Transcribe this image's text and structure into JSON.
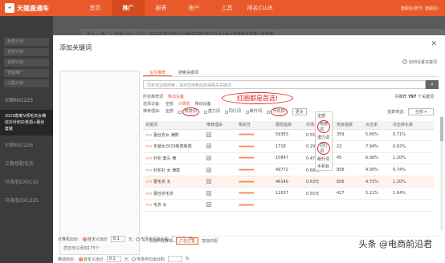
{
  "topbar": {
    "logo_text": "天猫直通车",
    "nav": [
      "首页",
      "推广",
      "报表",
      "账户",
      "工具",
      "排名CLUB"
    ],
    "active_index": 1,
    "user_text": "旗舰店(账号: 旗舰店)"
  },
  "sidebar": {
    "buttons": [
      "新建计划",
      "全部计划",
      "全部计划",
      "智能推广",
      "三联计划"
    ],
    "group_label": "V领R0I1225",
    "active_item": "2019款新V领毛衣女横纹衫针织衫低领+蕾丝套装",
    "items": [
      "V领R0I1226",
      "三套搭配毛衣",
      "马海毛DX0110",
      "马海毛DX1225"
    ]
  },
  "background": {
    "breadcrumb": "首页 > 推广 > 标准计划 > 宝贝 : 2019新款V领毛衣女横纹打底针织衫低领+蕾丝套装秋冬新款上衣外套"
  },
  "dialog": {
    "title": "添加关键词",
    "close_icon": "close-icon",
    "help_link": "如何设置关键词",
    "left_panel_footer": "您还可以添加175个",
    "tabs": [
      "宝贝推荐",
      "搜索关键词"
    ],
    "search_placeholder": "同步淘宝网搜索，请点击搜索后获得相关关键词",
    "filters": {
      "recommend_label": "所有推荐词",
      "recommend_sel": "移动设备",
      "device_label": "选择设备:",
      "device_options": [
        "全部",
        "计算机",
        "移动设备"
      ],
      "recommend_reason_label": "推荐理由:",
      "reasons": [
        "全部",
        "热搜词",
        "潜力词",
        "同行词",
        "飙升词",
        "手机标"
      ],
      "more_label": "更多",
      "total_label": "共推荐",
      "total_count": "797",
      "total_suffix": "个关键词",
      "sort_label": "指数筛选:",
      "sort_value": "全部",
      "annotation": "红圈都是首选!"
    },
    "dropdown": [
      "全部",
      "热搜词",
      "潜力词",
      "同行词",
      "飙升词",
      "手机标"
    ],
    "table": {
      "headers": [
        "关键词",
        "推荐理由",
        "相关性",
        "展现指数",
        "市场平均出价",
        "竞争指数",
        "点击率",
        "点击转化率"
      ],
      "rows": [
        {
          "kw": "蕾丝衣女 满款",
          "show": "59383",
          "bid": "0.55元",
          "comp": "359",
          "ctr": "5.66%",
          "cvr": "0.71%"
        },
        {
          "kw": "冬装女2019新款新款",
          "show": "1718",
          "bid": "0.29元",
          "comp": "22",
          "ctr": "7.94%",
          "cvr": "0.62%"
        },
        {
          "kw": "针织 套头 满",
          "show": "10847",
          "bid": "0.47元",
          "comp": "45",
          "ctr": "6.98%",
          "cvr": "1.20%"
        },
        {
          "kw": "针织衫 女 满款",
          "show": "49772",
          "bid": "0.68元",
          "comp": "958",
          "ctr": "4.99%",
          "cvr": "0.74%"
        },
        {
          "kw": "蕾毛衣 女",
          "show": "46140",
          "bid": "0.63元",
          "comp": "656",
          "ctr": "4.75%",
          "cvr": "1.20%"
        },
        {
          "kw": "蕾丝衣毛衣",
          "show": "11637",
          "bid": "0.55元",
          "comp": "427",
          "ctr": "5.21%",
          "cvr": "1.64%"
        },
        {
          "kw": "毛衣 女",
          "show": "",
          "bid": "",
          "comp": "",
          "ctr": "",
          "cvr": ""
        }
      ],
      "add_prefix": "<<",
      "highlight_row": 4
    },
    "bottom_bar": {
      "label": "添加所有推荐",
      "tabs": [
        "广告位置",
        "智能匹配"
      ]
    },
    "bid_rows": [
      {
        "label": "计算机出价:",
        "options": [
          "自定义出价",
          "市场平均出价的"
        ],
        "value": "0.1",
        "unit": "元",
        "pct": "%"
      },
      {
        "label": "移动出价:",
        "options": [
          "自定义出价",
          "市场平均出价的"
        ],
        "value": "0.1",
        "unit": "元",
        "pct": "%"
      }
    ]
  },
  "watermark": "头条 @电商前沿君"
}
